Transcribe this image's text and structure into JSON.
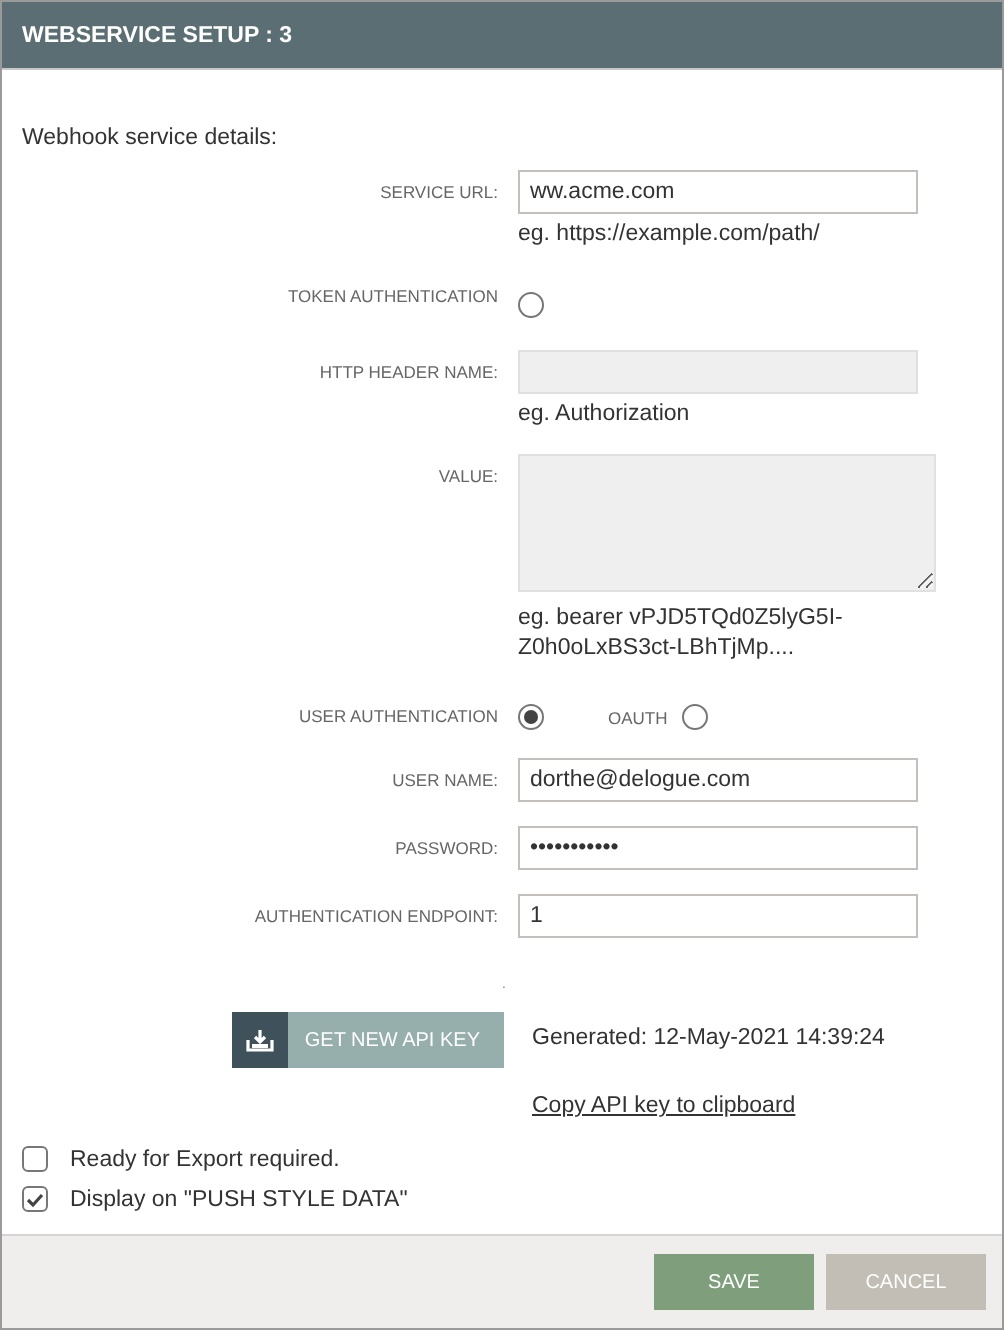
{
  "dialog": {
    "title": "WEBSERVICE SETUP : 3"
  },
  "section_title": "Webhook service details:",
  "fields": [
    {
      "kind": "input",
      "label": "SERVICE URL:",
      "value": "ww.acme.com",
      "hint": "eg. https://example.com/path/",
      "disabled": false
    },
    {
      "kind": "radio",
      "label": "TOKEN AUTHENTICATION",
      "selected": false
    },
    {
      "kind": "input",
      "label": "HTTP HEADER NAME:",
      "hint": "eg. Authorization",
      "disabled": true
    },
    {
      "kind": "textarea",
      "label": "VALUE:",
      "hint_lines": [
        "eg. bearer vPJD5TQd0Z5lyG5I-",
        "Z0h0oLxBS3ct-LBhTjMp...."
      ],
      "disabled": true
    },
    {
      "kind": "radio_pair",
      "label": "USER AUTHENTICATION",
      "selected": true,
      "option": {
        "label": "OAUTH",
        "selected": false
      }
    },
    {
      "kind": "input",
      "label": "USER NAME:",
      "value": "dorthe@delogue.com",
      "disabled": false
    },
    {
      "kind": "input",
      "label": "PASSWORD:",
      "value": "•••••••••••",
      "disabled": false
    },
    {
      "kind": "input",
      "label": "AUTHENTICATION ENDPOINT:",
      "value": "1",
      "disabled": false
    }
  ],
  "separator_mark": ".",
  "api_key": {
    "button": "GET NEW API KEY",
    "generated": "Generated: 12-May-2021 14:39:24",
    "copy_link": "Copy API key to clipboard"
  },
  "checkboxes": [
    {
      "label": "Ready for Export required.",
      "checked": false
    },
    {
      "label": "Display on \"PUSH STYLE DATA\"",
      "checked": true
    }
  ],
  "buttons": [
    {
      "label": "SAVE",
      "kind": "primary"
    },
    {
      "label": "CANCEL",
      "kind": "secondary"
    }
  ]
}
